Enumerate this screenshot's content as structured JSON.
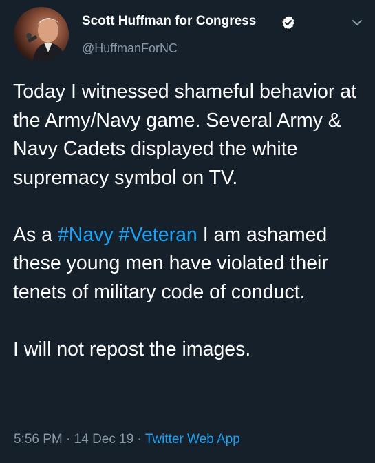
{
  "author": {
    "display_name": "Scott Huffman for Congress",
    "handle": "@HuffmanForNC",
    "avatar_icon": "profile-photo"
  },
  "tweet": {
    "paragraph_1": "Today I witnessed shameful behavior at the Army/Navy game. Several Army & Navy Cadets displayed the white supremacy symbol on TV.",
    "paragraph_2_prefix": "As a ",
    "hashtag_1": "#Navy",
    "hashtag_2": "#Veteran",
    "paragraph_2_suffix": " I am ashamed these young men have violated their tenets of military code of conduct.",
    "paragraph_3": "I will not repost the images."
  },
  "meta": {
    "time": "5:56 PM",
    "separator": " · ",
    "date": "14 Dec 19",
    "source": "Twitter Web App"
  },
  "colors": {
    "background": "#15202b",
    "text": "#ffffff",
    "secondary": "#8899a6",
    "link": "#1da1f2"
  },
  "icons": {
    "verified": "verified-badge-icon",
    "menu": "chevron-down-icon"
  }
}
